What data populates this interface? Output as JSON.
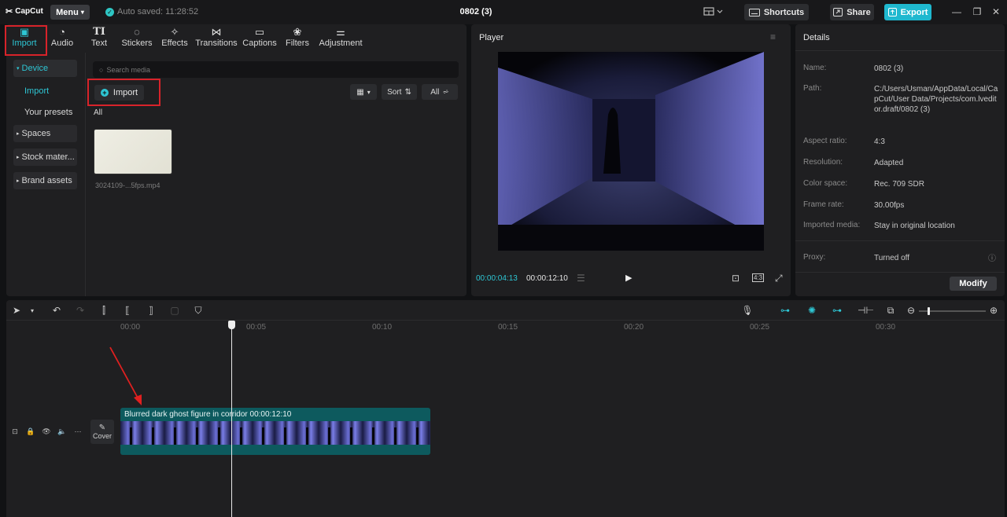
{
  "app": {
    "logo": "CapCut",
    "menu_label": "Menu",
    "autosave": "Auto saved: 11:28:52",
    "project_title": "0802 (3)",
    "shortcuts_label": "Shortcuts",
    "share_label": "Share",
    "export_label": "Export",
    "accent_color": "#2ec6d4"
  },
  "tool_tabs": [
    {
      "label": "Import",
      "icon": "import-icon"
    },
    {
      "label": "Audio",
      "icon": "audio-icon"
    },
    {
      "label": "Text",
      "icon": "text-icon"
    },
    {
      "label": "Stickers",
      "icon": "stickers-icon"
    },
    {
      "label": "Effects",
      "icon": "effects-icon"
    },
    {
      "label": "Transitions",
      "icon": "transitions-icon"
    },
    {
      "label": "Captions",
      "icon": "captions-icon"
    },
    {
      "label": "Filters",
      "icon": "filters-icon"
    },
    {
      "label": "Adjustment",
      "icon": "adjustment-icon"
    }
  ],
  "media": {
    "nav": {
      "device": "Device",
      "import": "Import",
      "your_presets": "Your presets",
      "spaces": "Spaces",
      "stock": "Stock mater...",
      "brand": "Brand assets"
    },
    "search_placeholder": "Search media",
    "import_button": "Import",
    "sort_label": "Sort",
    "filter_label": "All",
    "all_label": "All",
    "file_name": "3024109-...5fps.mp4"
  },
  "player": {
    "title": "Player",
    "current_time": "00:00:04:13",
    "total_time": "00:00:12:10",
    "ratio_label": "4:3"
  },
  "details": {
    "title": "Details",
    "rows": [
      {
        "key": "Name:",
        "value": "0802 (3)"
      },
      {
        "key": "Path:",
        "value": "C:/Users/Usman/AppData/Local/CapCut/User Data/Projects/com.lveditor.draft/0802 (3)"
      },
      {
        "key": "Aspect ratio:",
        "value": "4:3"
      },
      {
        "key": "Resolution:",
        "value": "Adapted"
      },
      {
        "key": "Color space:",
        "value": "Rec. 709 SDR"
      },
      {
        "key": "Frame rate:",
        "value": "30.00fps"
      },
      {
        "key": "Imported media:",
        "value": "Stay in original location"
      },
      {
        "key": "Proxy:",
        "value": "Turned off"
      }
    ],
    "modify_label": "Modify"
  },
  "timeline": {
    "ruler": [
      "00:00",
      "00:05",
      "00:10",
      "00:15",
      "00:20",
      "00:25",
      "00:30"
    ],
    "clip_label": "Blurred dark ghost figure in corridor  00:00:12:10",
    "cover_label": "Cover"
  }
}
